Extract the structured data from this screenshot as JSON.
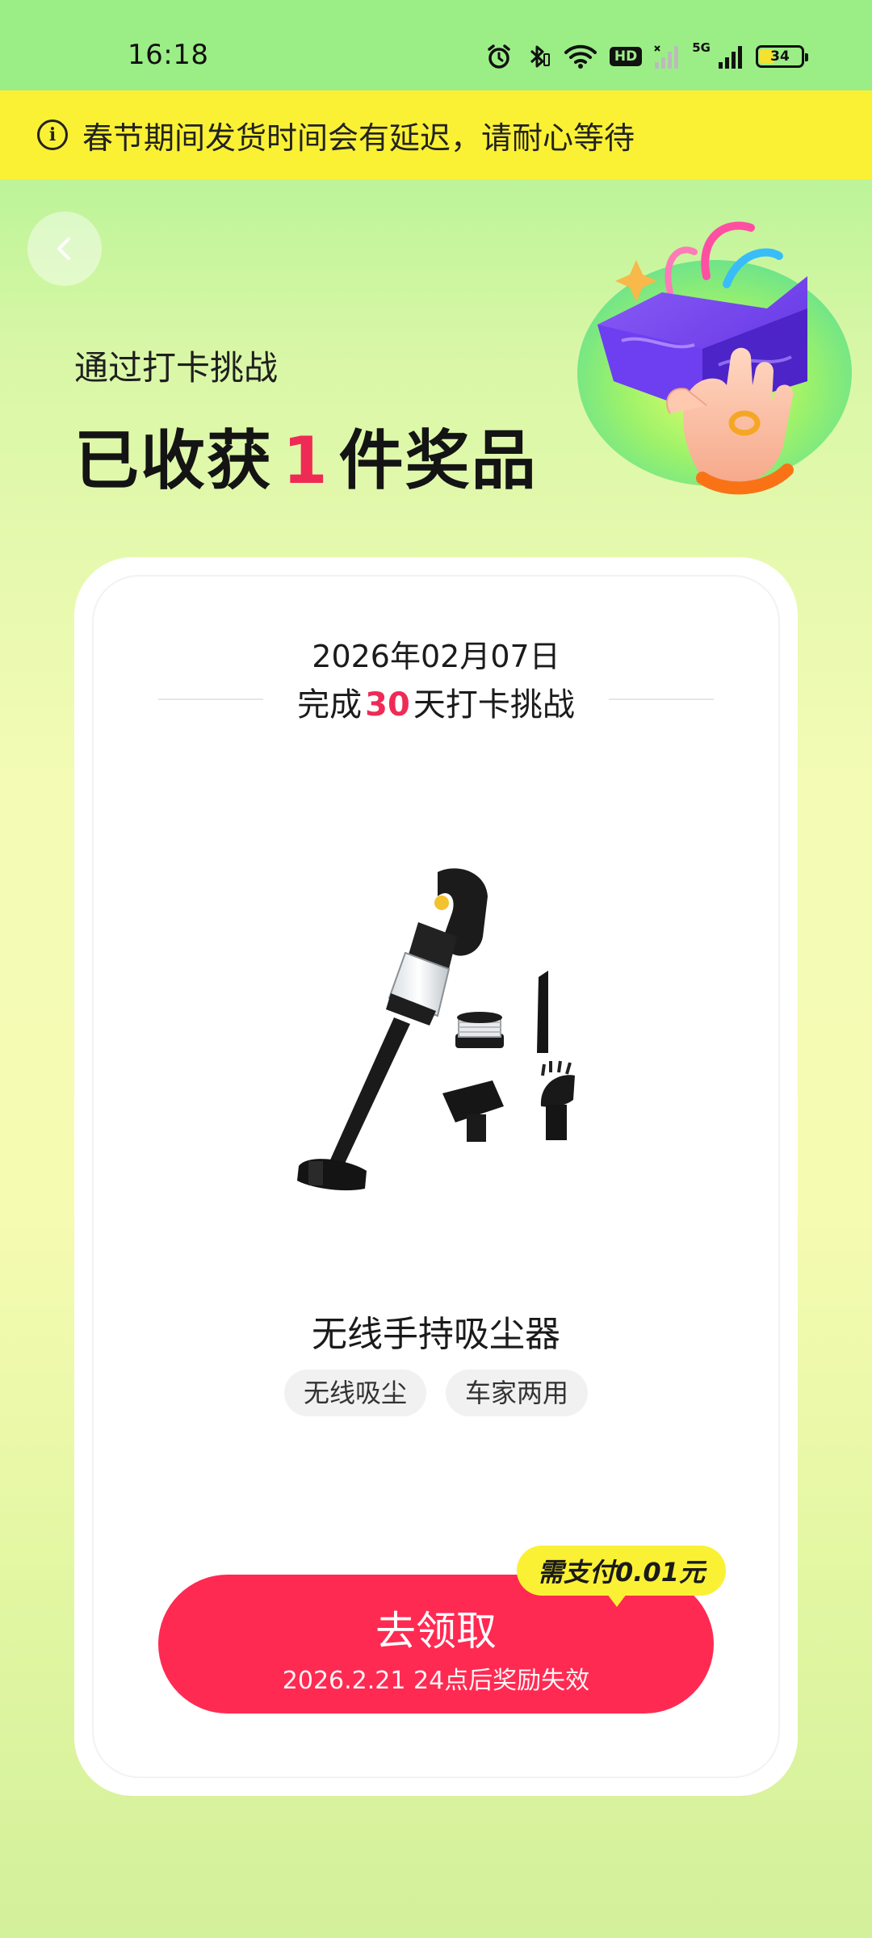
{
  "status_bar": {
    "time": "16:18",
    "hd_label": "HD",
    "network_label": "5G",
    "battery": "34",
    "icons": [
      "alarm-icon",
      "bluetooth-icon",
      "wifi-icon",
      "hd-icon",
      "signal-icon",
      "signal-5g-icon",
      "battery-icon"
    ]
  },
  "notice": {
    "icon": "info-icon",
    "text": "春节期间发货时间会有延迟，请耐心等待"
  },
  "header": {
    "back_icon": "chevron-left-icon",
    "subtitle": "通过打卡挑战",
    "title_prefix": "已收获",
    "title_count": "1",
    "title_suffix": "件奖品"
  },
  "card": {
    "date": "2026年02月07日",
    "challenge_prefix": "完成",
    "challenge_days": "30",
    "challenge_suffix": "天打卡挑战",
    "product": {
      "image": "vacuum-cleaner-image",
      "name": "无线手持吸尘器",
      "tags": [
        "无线吸尘",
        "车家两用"
      ]
    },
    "claim": {
      "label": "去领取",
      "expiry": "2026.2.21 24点后奖励失效",
      "pay_badge": "需支付0.01元"
    }
  },
  "colors": {
    "accent_red": "#ff2a52",
    "highlight_red": "#ef2b55",
    "banner_yellow": "#fbf134",
    "status_green": "#9bee86"
  }
}
